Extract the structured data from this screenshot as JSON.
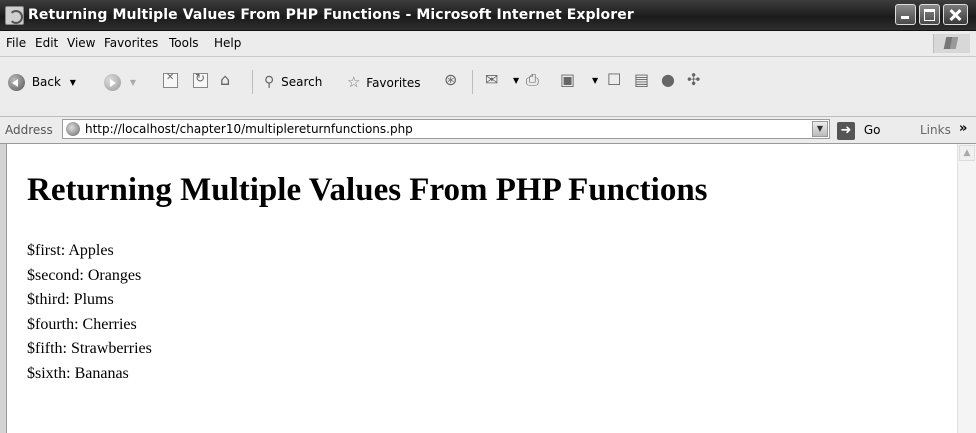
{
  "window": {
    "title": "Returning Multiple Values From PHP Functions - Microsoft Internet Explorer"
  },
  "menu": [
    "File",
    "Edit",
    "View",
    "Favorites",
    "Tools",
    "Help"
  ],
  "toolbar": {
    "back_label": "Back",
    "search_label": "Search",
    "favorites_label": "Favorites"
  },
  "address_bar": {
    "label": "Address",
    "url": "http://localhost/chapter10/multiplereturnfunctions.php",
    "go_label": "Go",
    "links_label": "Links",
    "links_chevron": "»"
  },
  "page": {
    "heading": "Returning Multiple Values From PHP Functions",
    "lines": [
      "$first: Apples",
      "$second: Oranges",
      "$third: Plums",
      "$fourth: Cherries",
      "$fifth: Strawberries",
      "$sixth: Bananas"
    ]
  }
}
